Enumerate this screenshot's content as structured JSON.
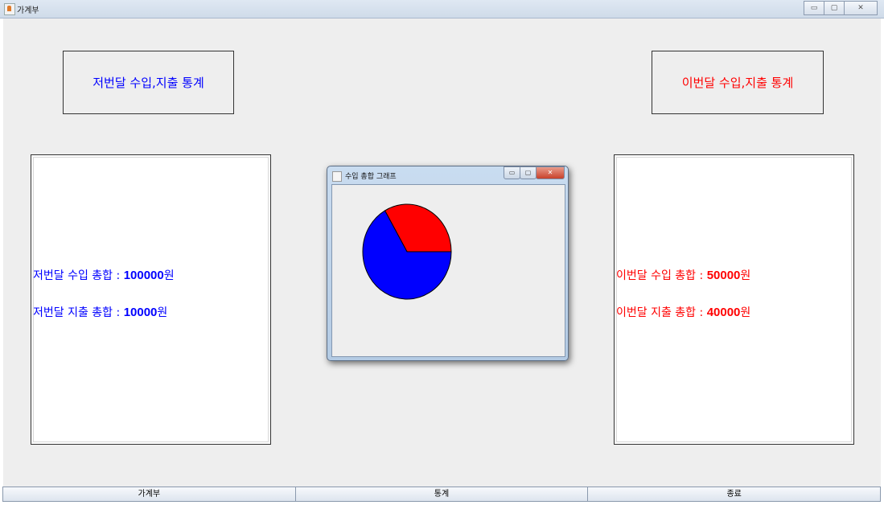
{
  "window": {
    "title": "가계부",
    "buttons": [
      "▭",
      "▢",
      "✕"
    ]
  },
  "last_month": {
    "header": "저번달 수입,지출 통계",
    "income_label": "저번달 수입 총합 : ",
    "income_value": "100000",
    "expense_label": "저번달 지출 총합 : ",
    "expense_value": "10000",
    "unit": "원",
    "color": "#0000ff"
  },
  "this_month": {
    "header": "이번달 수입,지출 통계",
    "income_label": "이번달 수입 총합 : ",
    "income_value": "50000",
    "expense_label": "이번달 지출 총합 : ",
    "expense_value": "40000",
    "unit": "원",
    "color": "#ff0000"
  },
  "dialog": {
    "title": "수입 총합 그래프",
    "buttons": [
      "▭",
      "▢",
      "✕"
    ]
  },
  "pie": {
    "slices": [
      {
        "label": "last_month_income",
        "value": 100000,
        "color": "#0000ff"
      },
      {
        "label": "this_month_income",
        "value": 50000,
        "color": "#ff0000"
      }
    ]
  },
  "bottom_buttons": [
    "가계부",
    "통계",
    "종료"
  ]
}
